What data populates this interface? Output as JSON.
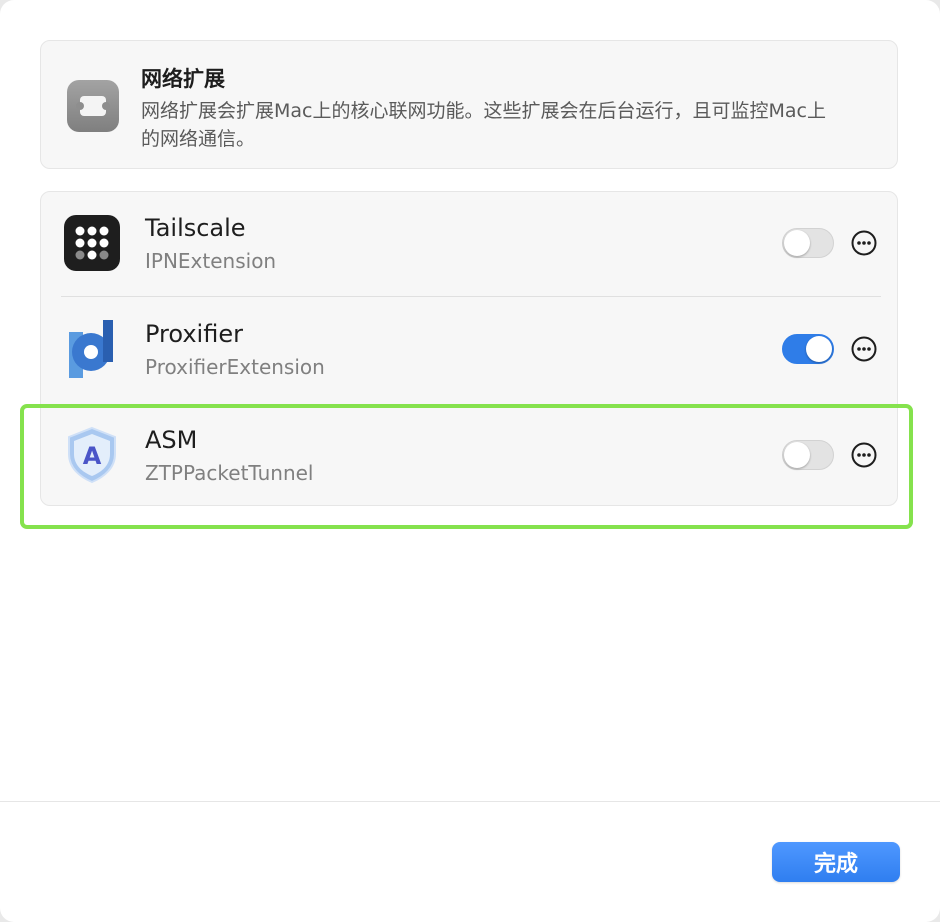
{
  "header": {
    "title": "网络扩展",
    "description": "网络扩展会扩展Mac上的核心联网功能。这些扩展会在后台运行，且可监控Mac上的网络通信。",
    "icon": "puzzle-icon"
  },
  "extensions": [
    {
      "name": "Tailscale",
      "identifier": "IPNExtension",
      "enabled": false,
      "icon": "tailscale-icon"
    },
    {
      "name": "Proxifier",
      "identifier": "ProxifierExtension",
      "enabled": true,
      "icon": "proxifier-icon"
    },
    {
      "name": "ASM",
      "identifier": "ZTPPacketTunnel",
      "enabled": false,
      "icon": "asm-shield-icon"
    }
  ],
  "footer": {
    "done_label": "完成"
  },
  "colors": {
    "accent": "#2f7de8",
    "highlight": "#85e24d",
    "toggle_off": "#e3e3e3"
  }
}
